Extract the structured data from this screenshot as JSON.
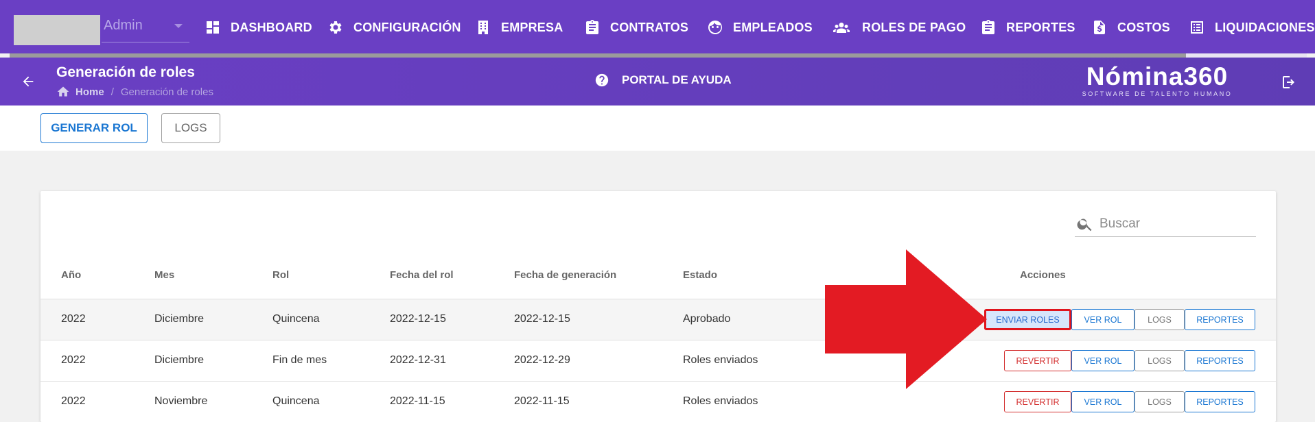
{
  "user": {
    "name": "Admin"
  },
  "nav": [
    {
      "key": "dashboard",
      "label": "DASHBOARD",
      "icon": "dashboard-icon"
    },
    {
      "key": "configuracion",
      "label": "CONFIGURACIÓN",
      "icon": "gear-icon"
    },
    {
      "key": "empresa",
      "label": "EMPRESA",
      "icon": "building-icon"
    },
    {
      "key": "contratos",
      "label": "CONTRATOS",
      "icon": "clipboard-icon"
    },
    {
      "key": "empleados",
      "label": "EMPLEADOS",
      "icon": "face-icon"
    },
    {
      "key": "roles-de-pago",
      "label": "ROLES DE PAGO",
      "icon": "people-icon"
    },
    {
      "key": "reportes",
      "label": "REPORTES",
      "icon": "clipboard-icon"
    },
    {
      "key": "costos",
      "label": "COSTOS",
      "icon": "invoice-icon"
    },
    {
      "key": "liquidaciones",
      "label": "LIQUIDACIONES",
      "icon": "list-icon"
    }
  ],
  "header": {
    "title": "Generación de roles",
    "breadcrumb": {
      "home": "Home",
      "current": "Generación de roles"
    },
    "help_label": "PORTAL DE AYUDA",
    "brand": {
      "name": "Nómina360",
      "tagline": "SOFTWARE DE TALENTO HUMANO"
    }
  },
  "toolbar": {
    "generate_label": "GENERAR ROL",
    "logs_label": "LOGS"
  },
  "search": {
    "placeholder": "Buscar"
  },
  "table": {
    "headers": {
      "year": "Año",
      "month": "Mes",
      "role": "Rol",
      "role_date": "Fecha del rol",
      "generated_date": "Fecha de generación",
      "status": "Estado",
      "actions": "Acciones"
    },
    "rows": [
      {
        "year": "2022",
        "month": "Diciembre",
        "role": "Quincena",
        "role_date": "2022-12-15",
        "generated_date": "2022-12-15",
        "status": "Aprobado",
        "primary_action": "ENVIAR ROLES",
        "view": "VER ROL",
        "logs": "LOGS",
        "reports": "REPORTES"
      },
      {
        "year": "2022",
        "month": "Diciembre",
        "role": "Fin de mes",
        "role_date": "2022-12-31",
        "generated_date": "2022-12-29",
        "status": "Roles enviados",
        "primary_action": "REVERTIR",
        "view": "VER ROL",
        "logs": "LOGS",
        "reports": "REPORTES"
      },
      {
        "year": "2022",
        "month": "Noviembre",
        "role": "Quincena",
        "role_date": "2022-11-15",
        "generated_date": "2022-11-15",
        "status": "Roles enviados",
        "primary_action": "REVERTIR",
        "view": "VER ROL",
        "logs": "LOGS",
        "reports": "REPORTES"
      }
    ]
  },
  "colors": {
    "nav_bg": "#6a3fc4",
    "primary": "#1976d2",
    "danger": "#d32f2f",
    "highlight_arrow": "#e31b23"
  }
}
